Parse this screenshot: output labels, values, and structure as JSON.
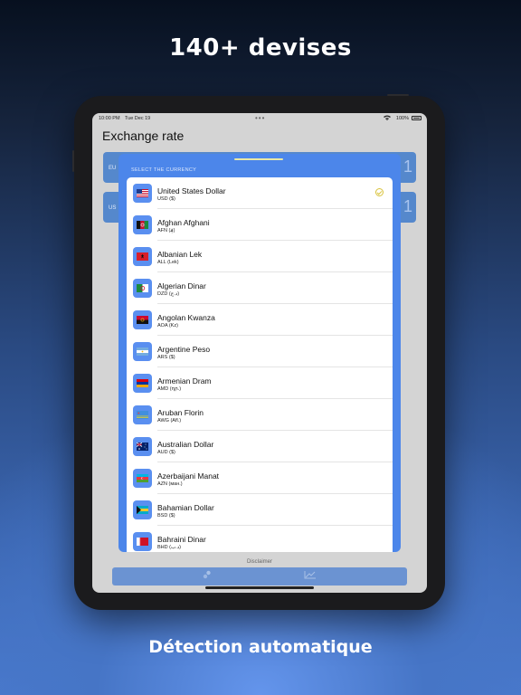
{
  "marketing": {
    "headline": "140+ devises",
    "footer": "Détection automatique"
  },
  "status_bar": {
    "time": "10:00 PM",
    "date": "Tue Dec 19",
    "battery": "100%"
  },
  "app": {
    "title": "Exchange rate",
    "cards": [
      {
        "code": "EU",
        "digit": "1"
      },
      {
        "code": "US",
        "digit": "1"
      }
    ],
    "disclaimer": "Disclaimer"
  },
  "sheet": {
    "title": "SELECT THE CURRENCY",
    "selected_index": 0,
    "currencies": [
      {
        "name": "United States Dollar",
        "code": "USD ($)"
      },
      {
        "name": "Afghan Afghani",
        "code": "AFN (؋)"
      },
      {
        "name": "Albanian Lek",
        "code": "ALL (Lek)"
      },
      {
        "name": "Algerian Dinar",
        "code": "DZD (د.ج)"
      },
      {
        "name": "Angolan Kwanza",
        "code": "AOA (Kz)"
      },
      {
        "name": "Argentine Peso",
        "code": "ARS ($)"
      },
      {
        "name": "Armenian Dram",
        "code": "AMD (դր.)"
      },
      {
        "name": "Aruban Florin",
        "code": "AWG (Afl.)"
      },
      {
        "name": "Australian Dollar",
        "code": "AUD ($)"
      },
      {
        "name": "Azerbaijani Manat",
        "code": "AZN (ман.)"
      },
      {
        "name": "Bahamian Dollar",
        "code": "BSD ($)"
      },
      {
        "name": "Bahraini Dinar",
        "code": "BHD (د.ب)"
      }
    ]
  },
  "colors": {
    "accent": "#4c86ea",
    "check": "#d8c23a"
  }
}
